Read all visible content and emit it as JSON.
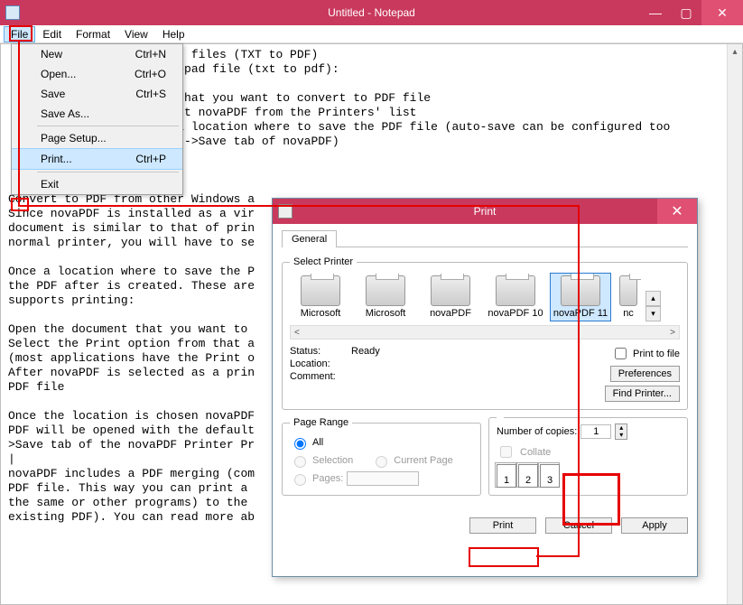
{
  "window": {
    "title": "Untitled - Notepad"
  },
  "menubar": [
    "File",
    "Edit",
    "Format",
    "View",
    "Help"
  ],
  "file_menu": {
    "items": [
      {
        "label": "New",
        "shortcut": "Ctrl+N"
      },
      {
        "label": "Open...",
        "shortcut": "Ctrl+O"
      },
      {
        "label": "Save",
        "shortcut": "Ctrl+S"
      },
      {
        "label": "Save As...",
        "shortcut": ""
      },
      {
        "sep": true
      },
      {
        "label": "Page Setup...",
        "shortcut": ""
      },
      {
        "label": "Print...",
        "shortcut": "Ctrl+P",
        "highlight": true
      },
      {
        "sep": true
      },
      {
        "label": "Exit",
        "shortcut": ""
      }
    ]
  },
  "editor": {
    "text": "                     text files (TXT to PDF)\n                     Notepad file (txt to pdf):\n\n                     nt that you want to convert to PDF file\n                     elect novaPDF from the Printers' list\n                     se a location where to save the PDF file (auto-save can be configured too\n                     ties->Save tab of novaPDF)\n\n\n\nConvert to PDF from other Windows a\nSince novaPDF is installed as a vir\ndocument is similar to that of prin\nnormal printer, you will have to se\n\nOnce a location where to save the P                                                      lay\nthe PDF after is created. These are\nsupports printing:\n\nOpen the document that you want to\nSelect the Print option from that a\n(most applications have the Print o\nAfter novaPDF is selected as a prin\nPDF file\n\nOnce the location is chosen novaPDF                                                      e\nPDF will be opened with the default                                                      s-\n>Save tab of the novaPDF Printer Pr\n|\nnovaPDF includes a PDF merging (com                                                      g\nPDF file. This way you can print a\nthe same or other programs) to the\nexisting PDF). You can read more ab"
  },
  "print_dialog": {
    "title": "Print",
    "tab": "General",
    "select_printer_label": "Select Printer",
    "printers": [
      "Microsoft",
      "Microsoft",
      "novaPDF",
      "novaPDF 10",
      "novaPDF 11",
      "nc"
    ],
    "selected_printer_index": 4,
    "status": {
      "label": "Status:",
      "value": "Ready"
    },
    "location": {
      "label": "Location:",
      "value": ""
    },
    "comment": {
      "label": "Comment:",
      "value": ""
    },
    "print_to_file_label": "Print to file",
    "preferences_btn": "Preferences",
    "find_printer_btn": "Find Printer...",
    "page_range": {
      "legend": "Page Range",
      "all": "All",
      "selection": "Selection",
      "current": "Current Page",
      "pages": "Pages:"
    },
    "copies": {
      "label": "Number of copies:",
      "value": "1",
      "collate": "Collate",
      "page_labels": [
        "1",
        "2",
        "3"
      ]
    },
    "buttons": {
      "print": "Print",
      "cancel": "Cancel",
      "apply": "Apply"
    }
  }
}
